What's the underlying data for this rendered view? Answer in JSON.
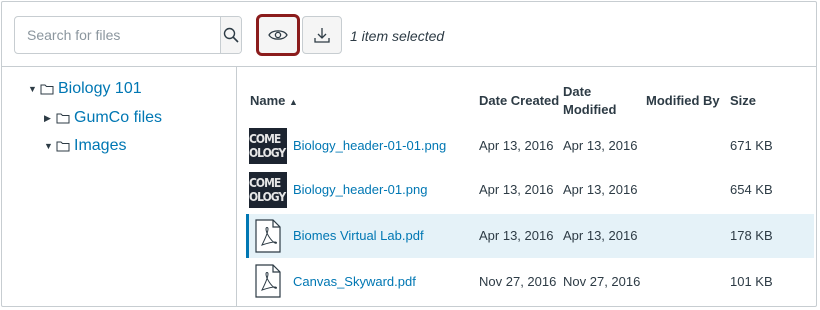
{
  "toolbar": {
    "search_placeholder": "Search for files",
    "selection_status": "1 item selected"
  },
  "tree": {
    "items": [
      {
        "label": "Biology 101",
        "expanded": true
      },
      {
        "label": "GumCo files",
        "expanded": false
      },
      {
        "label": "Images",
        "expanded": true
      }
    ]
  },
  "table": {
    "headers": {
      "name": "Name",
      "date_created": "Date Created",
      "date_modified_line1": "Date",
      "date_modified_line2": "Modified",
      "modified_by": "Modified By",
      "size": "Size"
    },
    "rows": [
      {
        "name": "Biology_header-01-01.png",
        "type": "image",
        "thumb_text_1": "COME",
        "thumb_text_2": "OLOGY",
        "date_created": "Apr 13, 2016",
        "date_modified": "Apr 13, 2016",
        "modified_by": "",
        "size": "671 KB",
        "selected": false
      },
      {
        "name": "Biology_header-01.png",
        "type": "image",
        "thumb_text_1": "COME",
        "thumb_text_2": "OLOGY",
        "date_created": "Apr 13, 2016",
        "date_modified": "Apr 13, 2016",
        "modified_by": "",
        "size": "654 KB",
        "selected": false
      },
      {
        "name": "Biomes Virtual Lab.pdf",
        "type": "pdf",
        "date_created": "Apr 13, 2016",
        "date_modified": "Apr 13, 2016",
        "modified_by": "",
        "size": "178 KB",
        "selected": true
      },
      {
        "name": "Canvas_Skyward.pdf",
        "type": "pdf",
        "date_created": "Nov 27, 2016",
        "date_modified": "Nov 27, 2016",
        "modified_by": "",
        "size": "101 KB",
        "selected": false
      }
    ]
  },
  "colors": {
    "link": "#0077b3",
    "selected_row": "#e5f2f8",
    "focus_ring": "#8b1c1c",
    "border": "#c7cdd1"
  },
  "icons": [
    "search-icon",
    "eye-icon",
    "download-icon",
    "folder-icon",
    "pdf-icon",
    "sort-asc-icon"
  ]
}
